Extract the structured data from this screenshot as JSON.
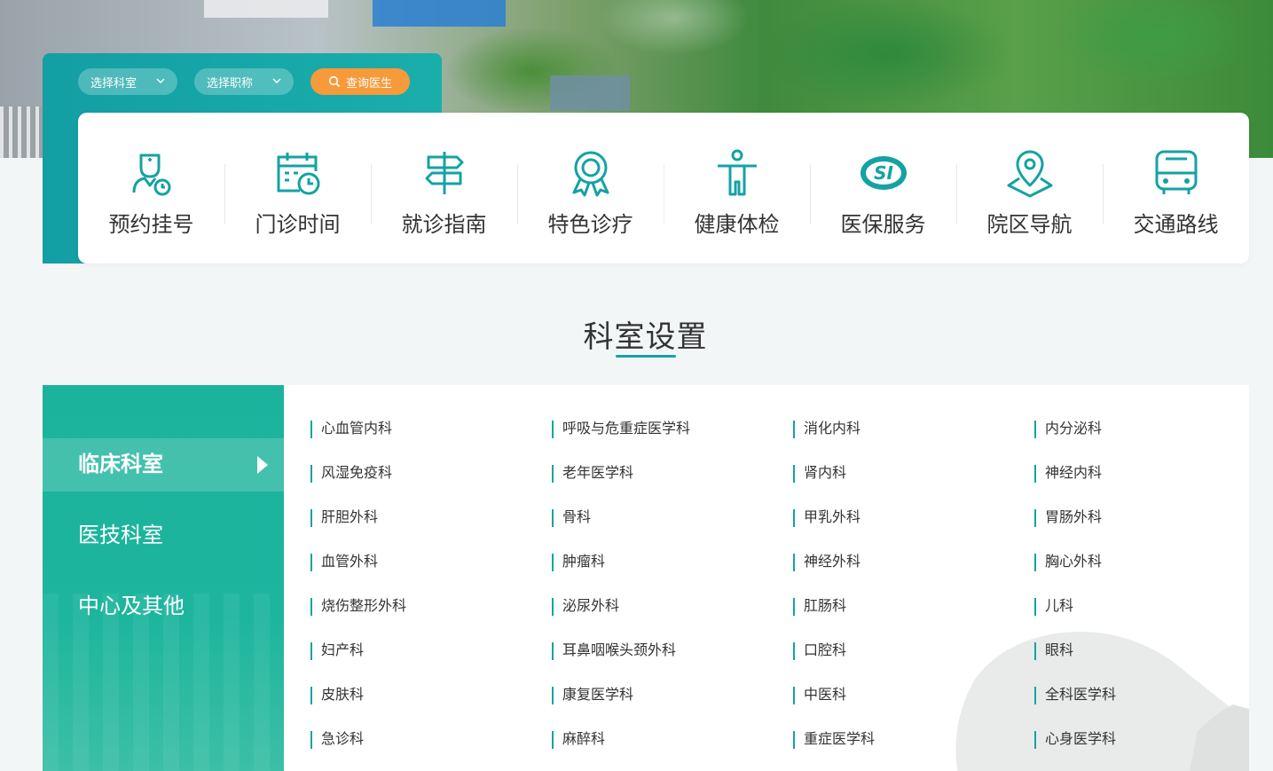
{
  "search": {
    "department_select": "选择科室",
    "title_select": "选择职称",
    "query_button": "查询医生"
  },
  "services": [
    {
      "label": "预约挂号",
      "icon": "doctor-appointment-icon"
    },
    {
      "label": "门诊时间",
      "icon": "calendar-clock-icon"
    },
    {
      "label": "就诊指南",
      "icon": "signpost-icon"
    },
    {
      "label": "特色诊疗",
      "icon": "award-ribbon-icon"
    },
    {
      "label": "健康体检",
      "icon": "person-fitness-icon"
    },
    {
      "label": "医保服务",
      "icon": "social-insurance-si-icon"
    },
    {
      "label": "院区导航",
      "icon": "map-pin-icon"
    },
    {
      "label": "交通路线",
      "icon": "bus-icon"
    }
  ],
  "section": {
    "title": "科室设置"
  },
  "dept_tabs": [
    {
      "label": "临床科室",
      "active": true
    },
    {
      "label": "医技科室",
      "active": false
    },
    {
      "label": "中心及其他",
      "active": false
    }
  ],
  "departments": [
    [
      "心血管内科",
      "呼吸与危重症医学科",
      "消化内科",
      "内分泌科"
    ],
    [
      "风湿免疫科",
      "老年医学科",
      "肾内科",
      "神经内科"
    ],
    [
      "肝胆外科",
      "骨科",
      "甲乳外科",
      "胃肠外科"
    ],
    [
      "血管外科",
      "肿瘤科",
      "神经外科",
      "胸心外科"
    ],
    [
      "烧伤整形外科",
      "泌尿外科",
      "肛肠科",
      "儿科"
    ],
    [
      "妇产科",
      "耳鼻咽喉头颈外科",
      "口腔科",
      "眼科"
    ],
    [
      "皮肤科",
      "康复医学科",
      "中医科",
      "全科医学科"
    ],
    [
      "急诊科",
      "麻醉科",
      "重症医学科",
      "心身医学科"
    ]
  ],
  "colors": {
    "teal": "#14a2a4",
    "green": "#1db59d",
    "orange": "#f79a3a"
  }
}
